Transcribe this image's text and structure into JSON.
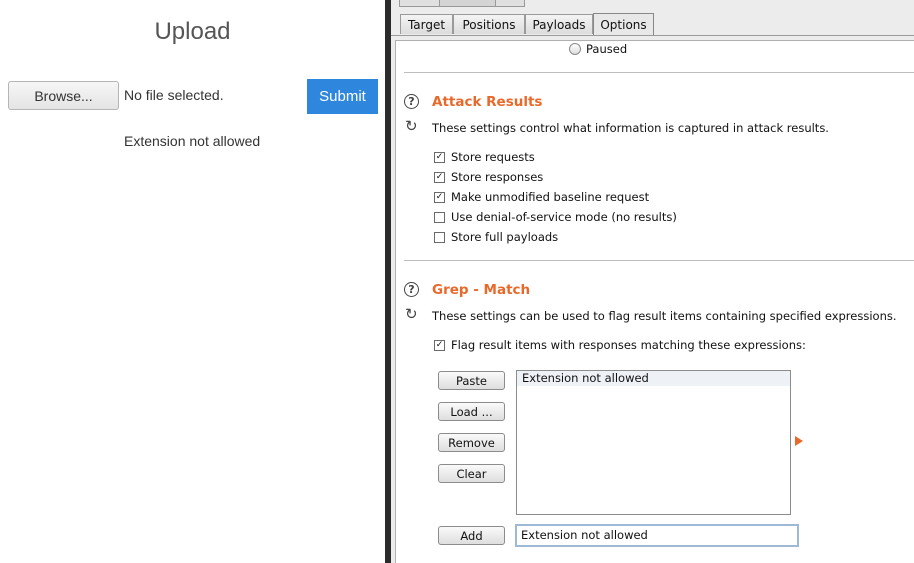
{
  "upload_page": {
    "title": "Upload",
    "browse_label": "Browse...",
    "file_status": "No file selected.",
    "submit_label": "Submit",
    "message": "Extension not allowed"
  },
  "burp": {
    "tabs": [
      {
        "label": "Target"
      },
      {
        "label": "Positions"
      },
      {
        "label": "Payloads"
      },
      {
        "label": "Options",
        "active": true
      }
    ],
    "paused_label": "Paused",
    "attack_results": {
      "title": "Attack Results",
      "description": "These settings control what information is captured in attack results.",
      "options": [
        {
          "label": "Store requests",
          "checked": true
        },
        {
          "label": "Store responses",
          "checked": true
        },
        {
          "label": "Make unmodified baseline request",
          "checked": true
        },
        {
          "label": "Use denial-of-service mode (no results)",
          "checked": false
        },
        {
          "label": "Store full payloads",
          "checked": false
        }
      ]
    },
    "grep_match": {
      "title": "Grep - Match",
      "description": "These settings can be used to flag result items containing specified expressions.",
      "flag_label": "Flag result items with responses matching these expressions:",
      "flag_checked": true,
      "buttons": {
        "paste": "Paste",
        "load": "Load ...",
        "remove": "Remove",
        "clear": "Clear",
        "add": "Add"
      },
      "list_items": [
        "Extension not allowed"
      ],
      "input_value": "Extension not allowed"
    },
    "colors": {
      "accent": "#e8692a",
      "submit_blue": "#2f86dd"
    }
  }
}
